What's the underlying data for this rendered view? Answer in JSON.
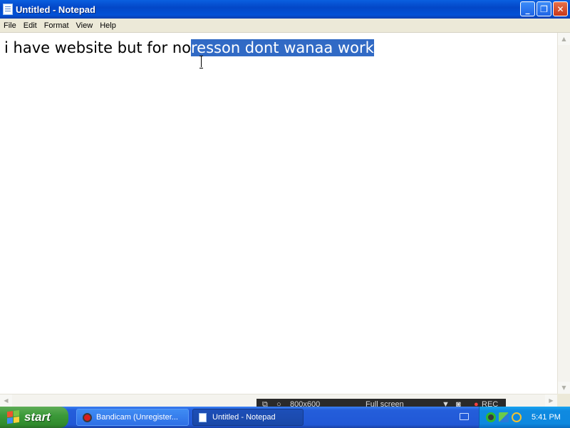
{
  "window": {
    "title": "Untitled - Notepad",
    "buttons": {
      "minimize": "_",
      "maximize": "❐",
      "close": "✕"
    }
  },
  "menu": [
    "File",
    "Edit",
    "Format",
    "View",
    "Help"
  ],
  "editor": {
    "text_unselected": "i have website but for no",
    "text_selected": "resson dont wanaa work"
  },
  "scrollbars": {
    "up": "▲",
    "down": "▼",
    "left": "◀",
    "right": "▶"
  },
  "bandicam_overlay": {
    "size": "800x600",
    "mode": "Full screen",
    "rec": "REC"
  },
  "taskbar": {
    "start_label": "start",
    "tasks": [
      {
        "label": "Bandicam (Unregister...",
        "icon": "record-icon"
      },
      {
        "label": "Untitled - Notepad",
        "icon": "notepad-icon"
      }
    ],
    "clock": "5:41 PM"
  },
  "colors": {
    "selection": "#316ac5",
    "titlebar": "#0347c7",
    "start_button": "#3c9a3a"
  }
}
